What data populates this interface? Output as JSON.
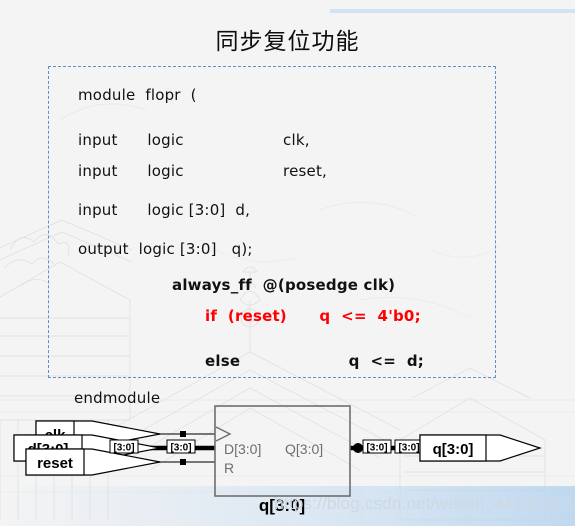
{
  "title": "同步复位功能",
  "code": {
    "module_decl": "module  flopr  (",
    "port_clk": "input      logic                    clk,",
    "port_reset": "input      logic                    reset,",
    "port_d": "input      logic [3:0]  d,",
    "port_q": "output  logic [3:0]   q);",
    "always_block": "always_ff  @(posedge clk)",
    "if_reset": "if  (reset)      q  <=  4'b0;",
    "else_branch": "else                    q  <=  d;",
    "endmodule": "endmodule"
  },
  "schematic": {
    "input_ports": [
      {
        "label": "clk"
      },
      {
        "label": "d[3:0]"
      },
      {
        "label": "reset"
      }
    ],
    "bus_labels": [
      {
        "label": "[3:0]"
      },
      {
        "label": "[3:0]"
      },
      {
        "label": "[3:0]"
      },
      {
        "label": "[3:0]"
      }
    ],
    "block": {
      "pin_d": "D[3:0]",
      "pin_q": "Q[3:0]",
      "pin_r": "R",
      "instance_label": "q[3:0]"
    },
    "output_port": {
      "label": "q[3:0]"
    }
  },
  "watermark": {
    "url": "https://blog.csdn.net/weixin_44145782"
  },
  "colors": {
    "accent_rule": "#d4e3f2",
    "panel_border": "#5b8fd0",
    "highlight_text": "#ff0000",
    "page_bg": "#f4f4f4"
  }
}
